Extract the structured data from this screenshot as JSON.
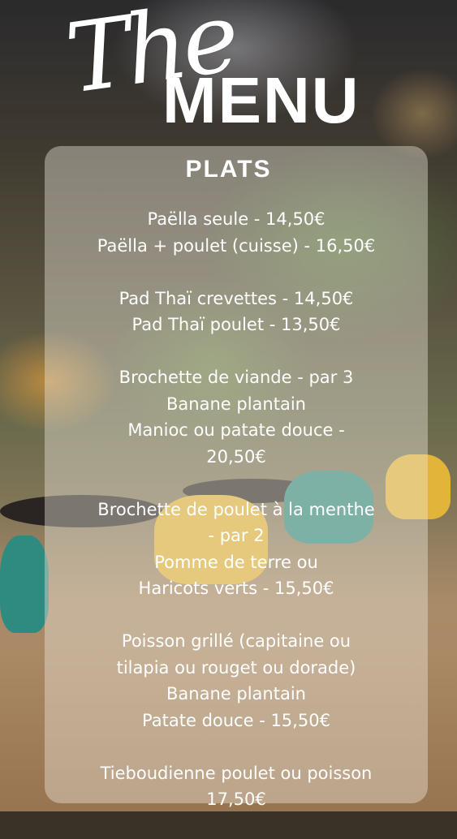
{
  "header": {
    "title_script": "The",
    "title_main": "MENU"
  },
  "section": {
    "title": "PLATS"
  },
  "menu_items": [
    {
      "lines": [
        "Paëlla seule - 14,50€",
        "Paëlla + poulet (cuisse) - 16,50€"
      ]
    },
    {
      "lines": [
        "Pad Thaï crevettes - 14,50€",
        "Pad Thaï poulet - 13,50€"
      ]
    },
    {
      "lines": [
        "Brochette de viande - par 3",
        "Banane plantain",
        "Manioc ou patate douce -",
        "20,50€"
      ]
    },
    {
      "lines": [
        "Brochette de poulet à la menthe",
        "- par 2",
        "Pomme de terre ou",
        "Haricots verts - 15,50€"
      ]
    },
    {
      "lines": [
        "Poisson grillé (capitaine ou",
        "tilapia ou rouget ou dorade)",
        "Banane plantain",
        "Patate douce - 15,50€"
      ]
    },
    {
      "lines": [
        "Tieboudienne poulet ou poisson",
        "17,50€"
      ]
    }
  ],
  "colors": {
    "text": "#ffffff",
    "panel": "rgba(235,232,220,0.42)",
    "chair_teal": "#2f8a80",
    "chair_yellow": "#e2b43a"
  }
}
